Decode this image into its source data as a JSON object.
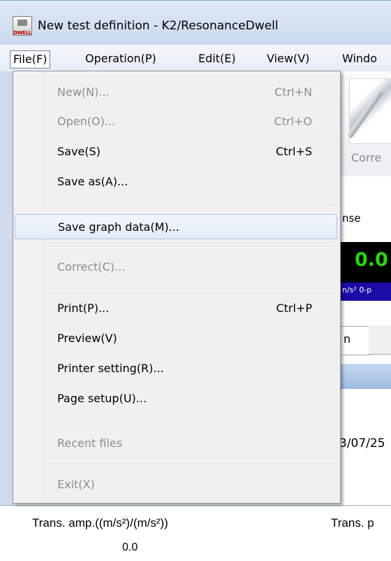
{
  "window": {
    "title": "New test definition - K2/ResonanceDwell",
    "icon_text": "DWELL"
  },
  "menubar": {
    "items": [
      {
        "label": "File(F)"
      },
      {
        "label": "Operation(P)"
      },
      {
        "label": "Edit(E)"
      },
      {
        "label": "View(V)"
      },
      {
        "label": "Windo"
      }
    ]
  },
  "file_menu": {
    "items": [
      {
        "label": "New(N)...",
        "shortcut": "Ctrl+N",
        "enabled": false
      },
      {
        "label": "Open(O)...",
        "shortcut": "Ctrl+O",
        "enabled": false
      },
      {
        "label": "Save(S)",
        "shortcut": "Ctrl+S",
        "enabled": true
      },
      {
        "label": "Save as(A)...",
        "shortcut": "",
        "enabled": true
      },
      {
        "label": "Save graph data(M)...",
        "shortcut": "",
        "enabled": true,
        "highlighted": true
      },
      {
        "label": "Correct(C)...",
        "shortcut": "",
        "enabled": false
      },
      {
        "label": "Print(P)...",
        "shortcut": "Ctrl+P",
        "enabled": true
      },
      {
        "label": "Preview(V)",
        "shortcut": "",
        "enabled": true
      },
      {
        "label": "Printer setting(R)...",
        "shortcut": "",
        "enabled": true
      },
      {
        "label": "Page setup(U)...",
        "shortcut": "",
        "enabled": true
      },
      {
        "label": "Recent files",
        "shortcut": "",
        "enabled": false
      },
      {
        "label": "Exit(X)",
        "shortcut": "",
        "enabled": false
      }
    ]
  },
  "background": {
    "toolbar_button_label": "Corre",
    "panel_label": "nse",
    "digital_value": "0.0",
    "unit_text": "n/s² 0-p",
    "tab_label": "n",
    "date_text": "3/07/25",
    "trans_amp_label": "Trans. amp.((m/s²)/(m/s²))",
    "trans_amp_value": "0.0",
    "trans_p_label": "Trans. p"
  },
  "colors": {
    "digital_text": "#27d60f",
    "unit_bar": "#1b0ca8",
    "menu_highlight_border": "#a8c6ee"
  }
}
